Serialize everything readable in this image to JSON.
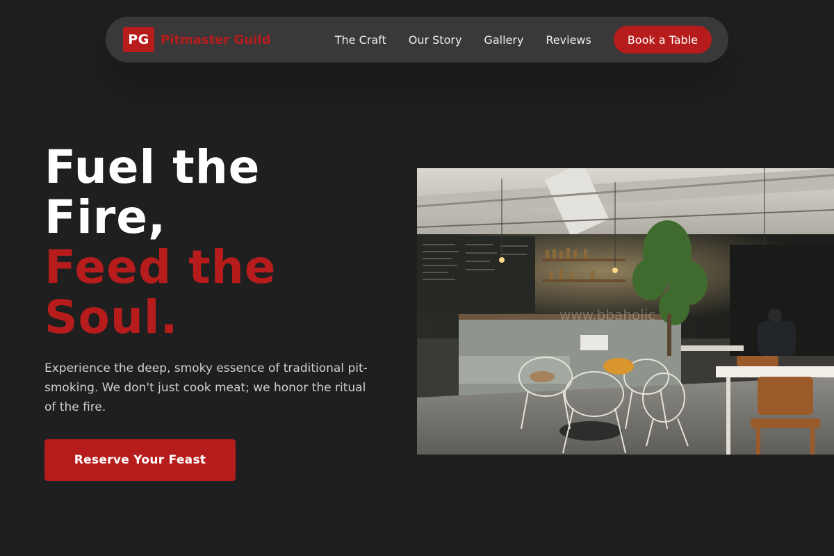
{
  "brand": {
    "logo_text": "PG",
    "name": "Pitmaster Guild"
  },
  "nav": {
    "links": [
      "The Craft",
      "Our Story",
      "Gallery",
      "Reviews"
    ],
    "cta_label": "Book a Table"
  },
  "hero": {
    "title_line1": "Fuel the",
    "title_line2": "Fire,",
    "title_line3": "Feed the",
    "title_line4": "Soul.",
    "description": "Experience the deep, smoky essence of traditional pit-smoking. We don't just cook meat; we honor the ritual of the fire.",
    "cta_label": "Reserve Your Feast",
    "image_alt": "restaurant interior photo"
  },
  "colors": {
    "background": "#1f1f1f",
    "nav_background": "#3a3838",
    "accent": "#b71c1c",
    "text_primary": "#ffffff",
    "text_secondary": "#cfcfcf"
  }
}
